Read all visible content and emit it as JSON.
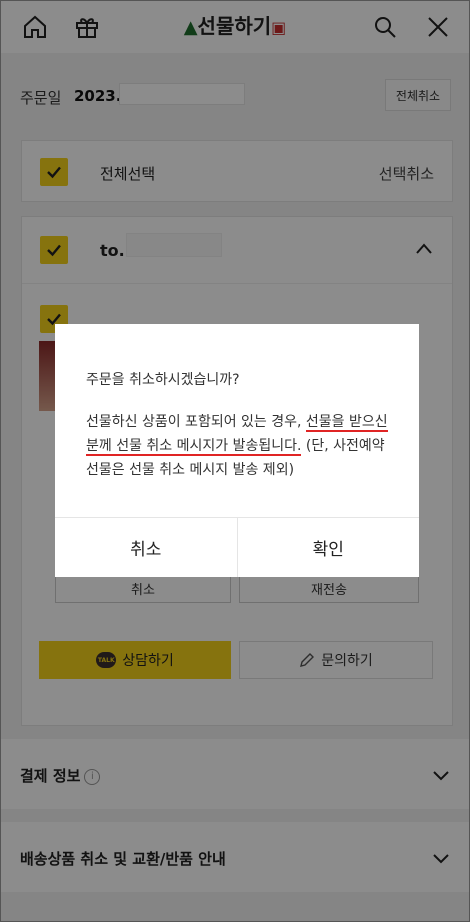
{
  "header": {
    "title": "선물하기",
    "home_icon": "home-icon",
    "gift_icon": "gift-icon",
    "search_icon": "search-icon",
    "close_icon": "close-icon"
  },
  "order": {
    "date_label": "주문일",
    "date_value": "2023.",
    "cancel_all_label": "전체취소"
  },
  "selection": {
    "select_all_label": "전체선택",
    "deselect_label": "선택취소"
  },
  "recipient": {
    "to_label": "to."
  },
  "item_actions": {
    "cancel_label": "취소",
    "resend_label": "재전송",
    "consult_label": "상담하기",
    "talk_badge": "TALK",
    "inquiry_label": "문의하기"
  },
  "sections": [
    {
      "label": "결제 정보"
    },
    {
      "label": "배송상품 취소 및 교환/반품 안내"
    }
  ],
  "dialog": {
    "question": "주문을 취소하시겠습니까?",
    "body_part1": "선물하신 상품이 포함되어 있는 경우,",
    "body_underlined_1": "선물을 받으신",
    "body_underlined_2": "분께 선물 취소 메시지가 발송됩니다.",
    "body_part2": "(단, 사전예약 선물은 선물 취소 메시지 발송 제외)",
    "cancel_button": "취소",
    "confirm_button": "확인"
  },
  "colors": {
    "accent_yellow": "#f5d21b",
    "underline_red": "#e02424"
  }
}
